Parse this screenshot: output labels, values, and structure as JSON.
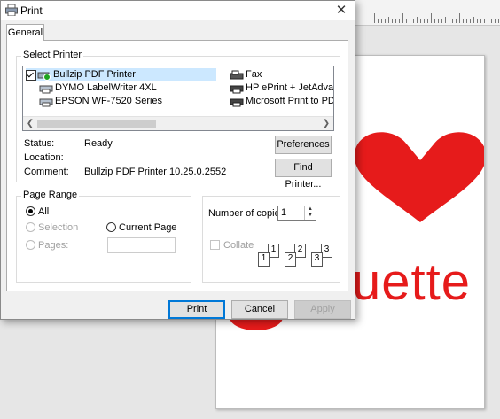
{
  "background": {
    "page_text": "uette",
    "heart_color": "#e61b1b"
  },
  "dialog": {
    "title": "Print",
    "tab_general": "General",
    "select_printer_label": "Select Printer",
    "printers": [
      {
        "name": "Bullzip PDF Printer",
        "selected": true,
        "icon": "pdf-printer-icon"
      },
      {
        "name": "DYMO LabelWriter 4XL",
        "selected": false,
        "icon": "printer-icon"
      },
      {
        "name": "EPSON WF-7520 Series",
        "selected": false,
        "icon": "printer-icon"
      },
      {
        "name": "Fax",
        "selected": false,
        "icon": "fax-icon"
      },
      {
        "name": "HP ePrint + JetAdvant",
        "selected": false,
        "icon": "printer-icon"
      },
      {
        "name": "Microsoft Print to PDF",
        "selected": false,
        "icon": "printer-icon"
      }
    ],
    "status_label": "Status:",
    "status_value": "Ready",
    "location_label": "Location:",
    "location_value": "",
    "comment_label": "Comment:",
    "comment_value": "Bullzip PDF Printer 10.25.0.2552",
    "preferences_button": "Preferences",
    "find_printer_button": "Find Printer...",
    "page_range_label": "Page Range",
    "range_all": "All",
    "range_selection": "Selection",
    "range_current_page": "Current Page",
    "range_pages": "Pages:",
    "pages_value": "",
    "copies_label": "Number of copies:",
    "copies_value": "1",
    "collate_label": "Collate",
    "print_button": "Print",
    "cancel_button": "Cancel",
    "apply_button": "Apply",
    "collate_digits": [
      "1",
      "1",
      "2",
      "2",
      "3",
      "3"
    ]
  }
}
